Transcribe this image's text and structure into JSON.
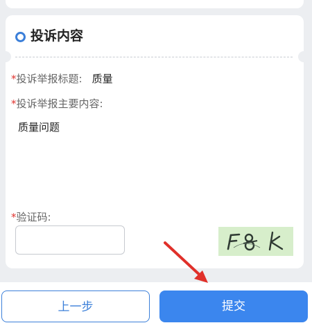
{
  "section": {
    "title": "投诉内容"
  },
  "form": {
    "subject_label": "投诉举报标题:",
    "subject_value": "质量",
    "content_label": "投诉举报主要内容:",
    "content_value": "质量问题",
    "captcha_label": "验证码:",
    "captcha_input_value": "",
    "captcha_text": "F8k",
    "required_mark": "*"
  },
  "buttons": {
    "prev_label": "上一步",
    "submit_label": "提交"
  },
  "colors": {
    "accent": "#3b86ee",
    "required": "#e0342f",
    "captcha_bg": "#d7eecb",
    "annotation_arrow": "#e0302a"
  },
  "icons": {
    "section_marker": "circle-dot-icon",
    "annotation": "red-arrow-icon"
  }
}
